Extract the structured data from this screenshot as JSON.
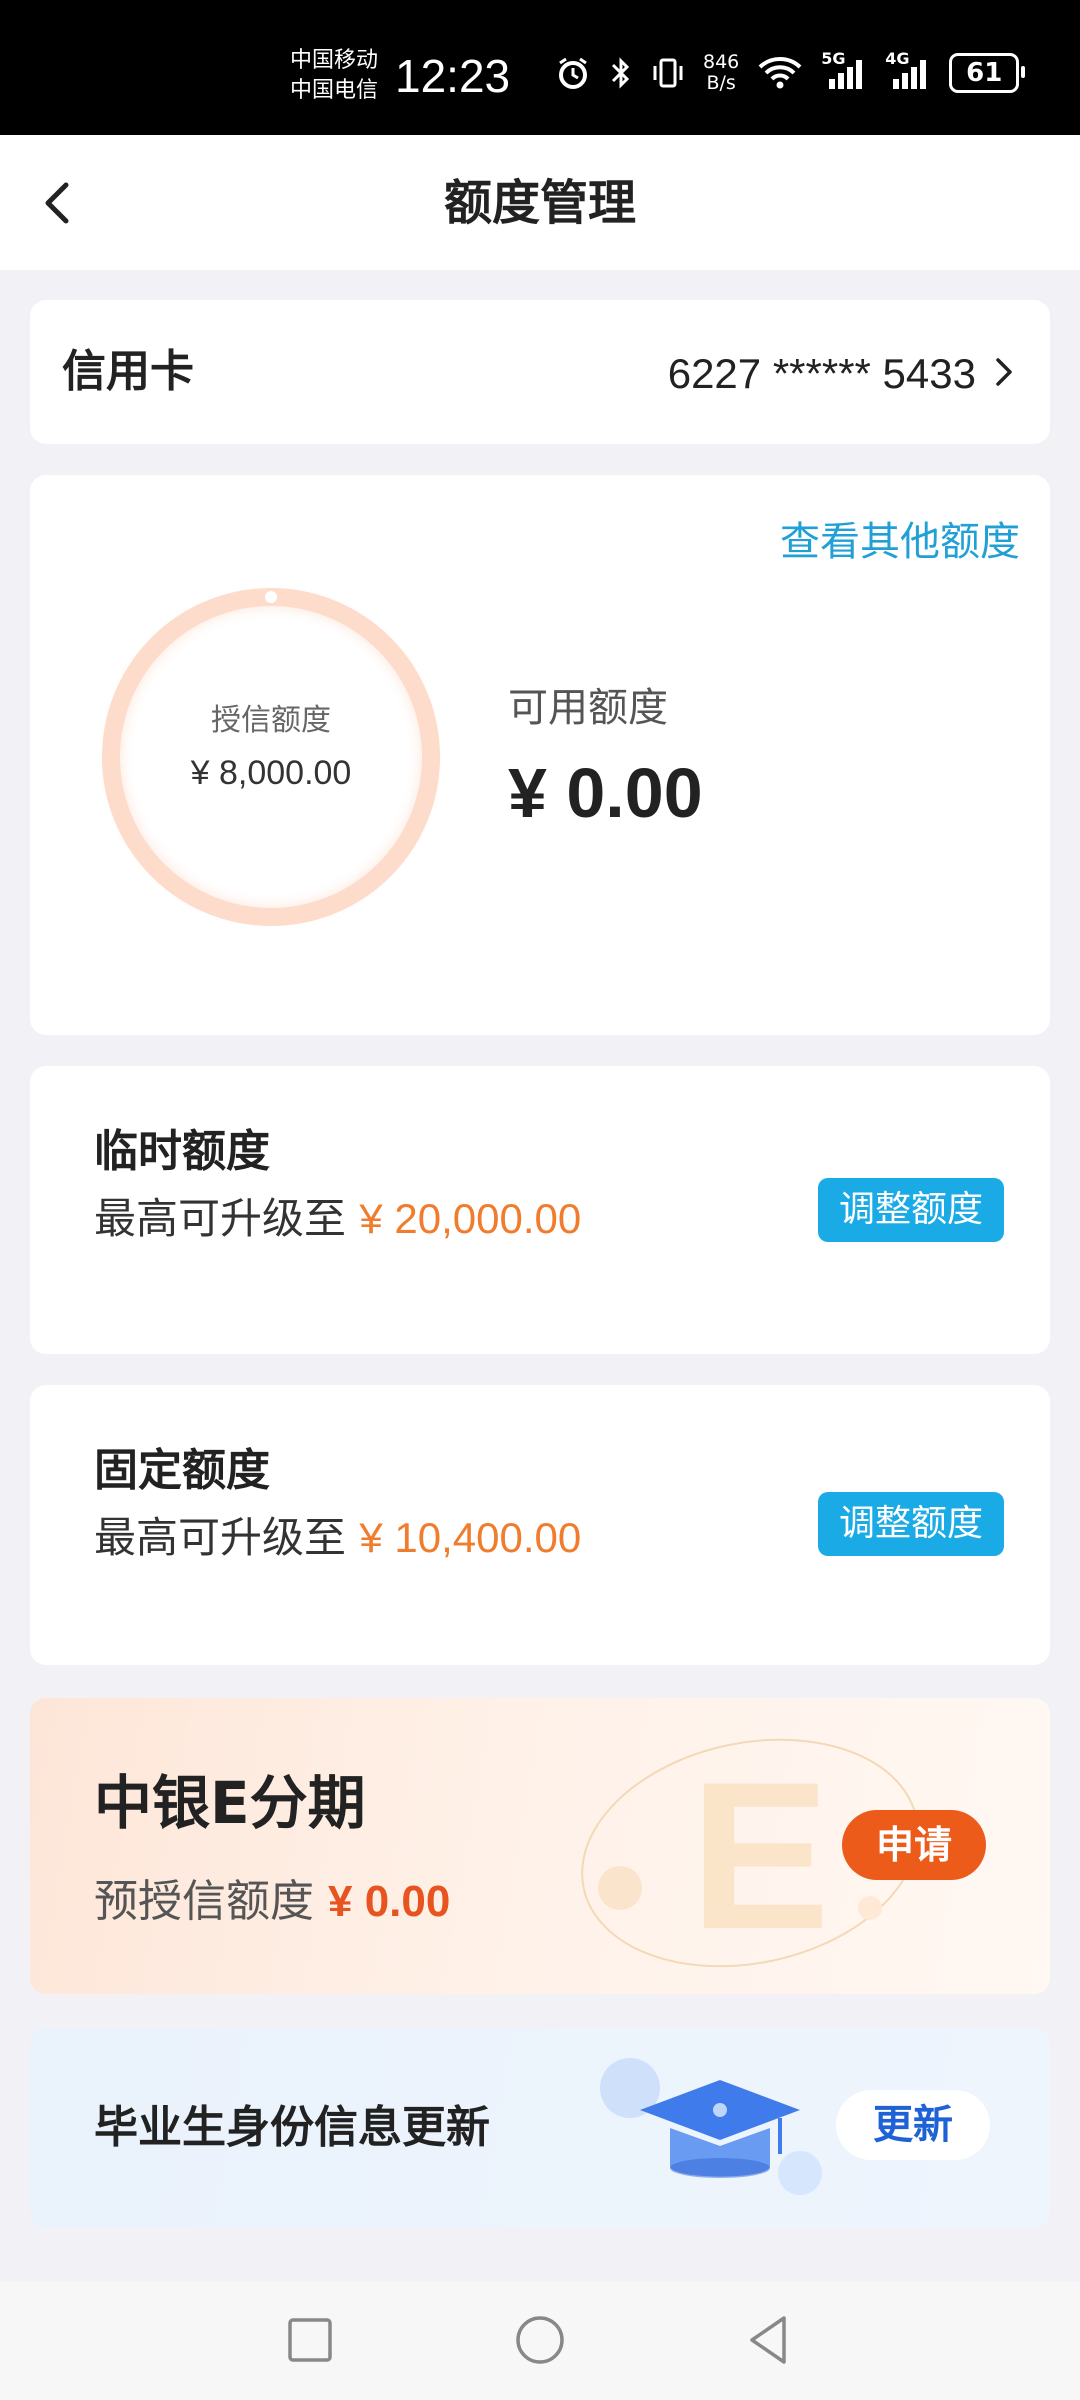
{
  "status_bar": {
    "carrier_1": "中国移动",
    "carrier_2": "中国电信",
    "time": "12:23",
    "net_speed_value": "846",
    "net_speed_unit": "B/s",
    "signal_1_label": "5G",
    "signal_2_label": "4G",
    "battery": "61"
  },
  "header": {
    "title": "额度管理"
  },
  "card_selector": {
    "label": "信用卡",
    "card_number": "6227 ****** 5433"
  },
  "limit_overview": {
    "other_limits_link": "查看其他额度",
    "credit_limit_label": "授信额度",
    "credit_limit_value": "¥ 8,000.00",
    "available_label": "可用额度",
    "available_value": "¥ 0.00"
  },
  "temporary_limit": {
    "title": "临时额度",
    "desc_prefix": "最高可升级至",
    "amount": "¥ 20,000.00",
    "button": "调整额度"
  },
  "fixed_limit": {
    "title": "固定额度",
    "desc_prefix": "最高可升级至",
    "amount": "¥ 10,400.00",
    "button": "调整额度"
  },
  "installment_banner": {
    "title": "中银E分期",
    "sub_prefix": "预授信额度",
    "amount": "¥ 0.00",
    "button": "申请"
  },
  "graduate_banner": {
    "title": "毕业生身份信息更新",
    "button": "更新"
  },
  "colors": {
    "accent_blue": "#1aaae6",
    "amount_orange": "#f07c2d",
    "apply_orange": "#ec5b1a",
    "update_blue": "#1e62d6"
  }
}
